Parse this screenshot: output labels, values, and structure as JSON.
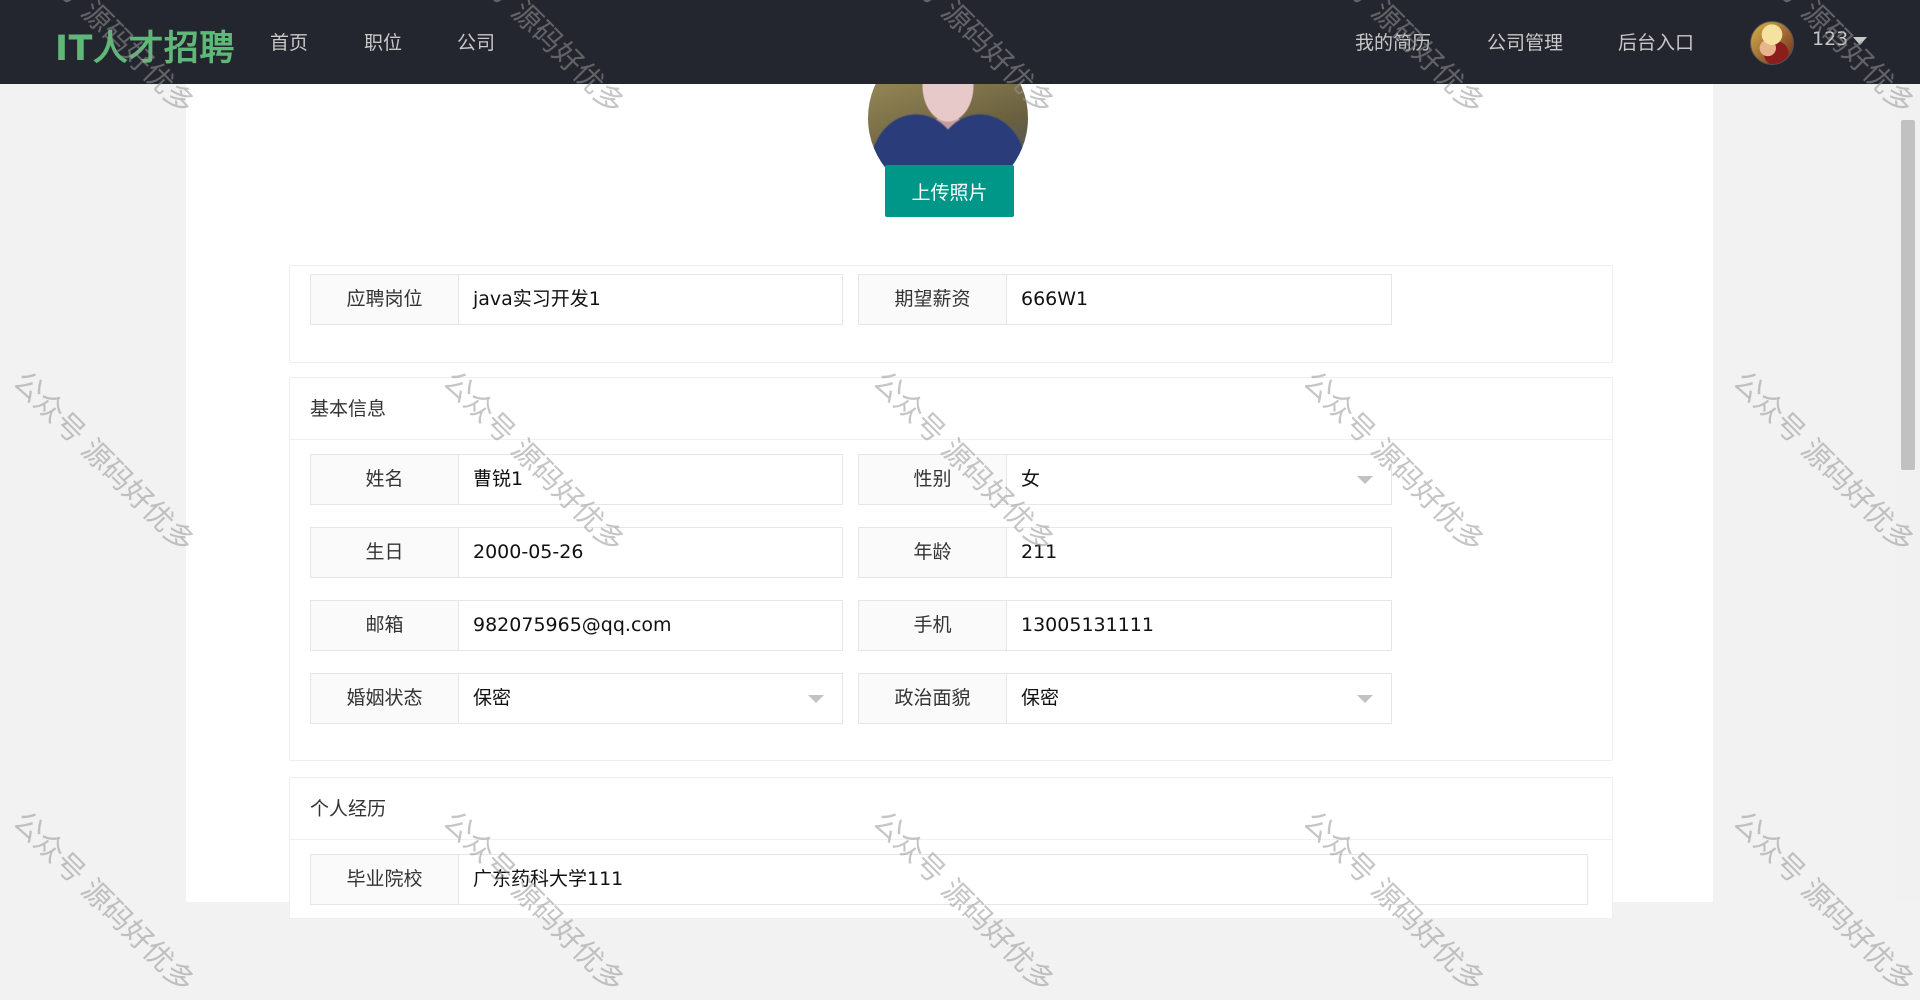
{
  "header": {
    "logo": "IT人才招聘",
    "nav": [
      {
        "label": "首页"
      },
      {
        "label": "职位"
      },
      {
        "label": "公司"
      }
    ],
    "right_nav": [
      {
        "label": "我的简历"
      },
      {
        "label": "公司管理"
      },
      {
        "label": "后台入口"
      }
    ],
    "user": {
      "name": "123"
    }
  },
  "photo": {
    "upload_label": "上传照片"
  },
  "job_section": {
    "position_label": "应聘岗位",
    "position_value": "java实习开发1",
    "salary_label": "期望薪资",
    "salary_value": "666W1"
  },
  "basic_info": {
    "title": "基本信息",
    "name_label": "姓名",
    "name_value": "曹锐1",
    "gender_label": "性别",
    "gender_value": "女",
    "birthday_label": "生日",
    "birthday_value": "2000-05-26",
    "age_label": "年龄",
    "age_value": "211",
    "email_label": "邮箱",
    "email_value": "982075965@qq.com",
    "phone_label": "手机",
    "phone_value": "13005131111",
    "marital_label": "婚姻状态",
    "marital_value": "保密",
    "political_label": "政治面貌",
    "political_value": "保密"
  },
  "experience": {
    "title": "个人经历",
    "school_label": "毕业院校",
    "school_value": "广东药科大学111"
  },
  "watermark": {
    "text": "公众号 源码好优多"
  },
  "colors": {
    "topbar": "#23262e",
    "logo": "#5fb878",
    "primary_button": "#009688"
  }
}
